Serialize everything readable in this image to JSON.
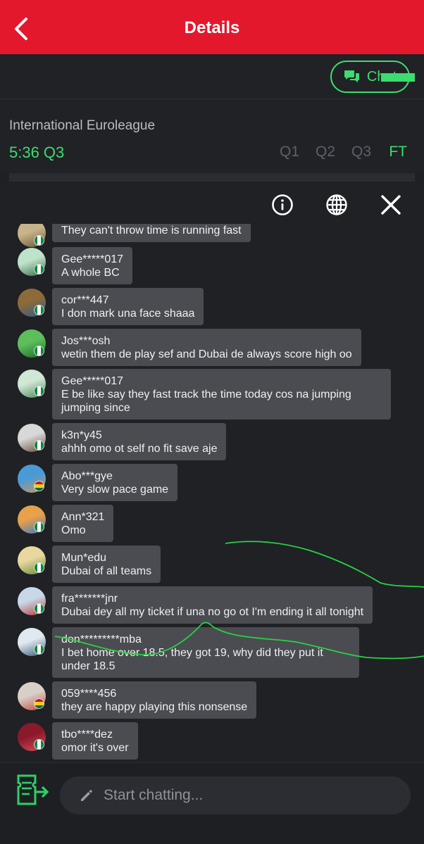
{
  "header": {
    "title": "Details",
    "back_icon": "chevron-left-icon"
  },
  "chat_button": {
    "label": "Chat",
    "icon": "chat-bubbles-icon"
  },
  "match": {
    "league": "International Euroleague",
    "clock": "5:36 Q3",
    "quarters": [
      "Q1",
      "Q2",
      "Q3",
      "FT"
    ],
    "active_quarter": "FT"
  },
  "panel_icons": [
    "info-icon",
    "globe-icon",
    "close-icon"
  ],
  "messages": [
    {
      "user": "",
      "text": "They can't throw time is running fast",
      "flag": "ng"
    },
    {
      "user": "Gee*****017",
      "text": "A whole BC",
      "flag": "ng"
    },
    {
      "user": "cor***447",
      "text": "I don mark una face shaaa",
      "flag": "ng"
    },
    {
      "user": "Jos***osh",
      "text": "wetin them de play sef and Dubai de always score high oo",
      "flag": "ng"
    },
    {
      "user": "Gee*****017",
      "text": "E be like say they fast track the time today cos na jumping jumping since",
      "flag": "ng"
    },
    {
      "user": "k3n*y45",
      "text": "ahhh omo ot self no fit save aje",
      "flag": "ng"
    },
    {
      "user": "Abo***gye",
      "text": "Very slow pace game",
      "flag": "gh"
    },
    {
      "user": "Ann*321",
      "text": "Omo",
      "flag": "ng"
    },
    {
      "user": "Mun*edu",
      "text": "Dubai of all teams",
      "flag": "ng"
    },
    {
      "user": "fra*******jnr",
      "text": "Dubai dey all my ticket if una no go ot I'm ending it all tonight",
      "flag": "ng"
    },
    {
      "user": "don*********mba",
      "text": "I bet home over 18.5, they got 19, why did they put it under 18.5",
      "flag": "ng"
    },
    {
      "user": "059****456",
      "text": "they are happy playing this nonsense",
      "flag": "gh"
    },
    {
      "user": "tbo****dez",
      "text": "omor it's over",
      "flag": "ng"
    }
  ],
  "composer": {
    "placeholder": "Start chatting...",
    "pencil_icon": "pencil-icon",
    "ticket_icon": "ticket-share-icon"
  },
  "colors": {
    "brand_red": "#e3182d",
    "accent_green": "#3ddc6f",
    "bubble": "#4a4c52",
    "background": "#1e2025"
  }
}
